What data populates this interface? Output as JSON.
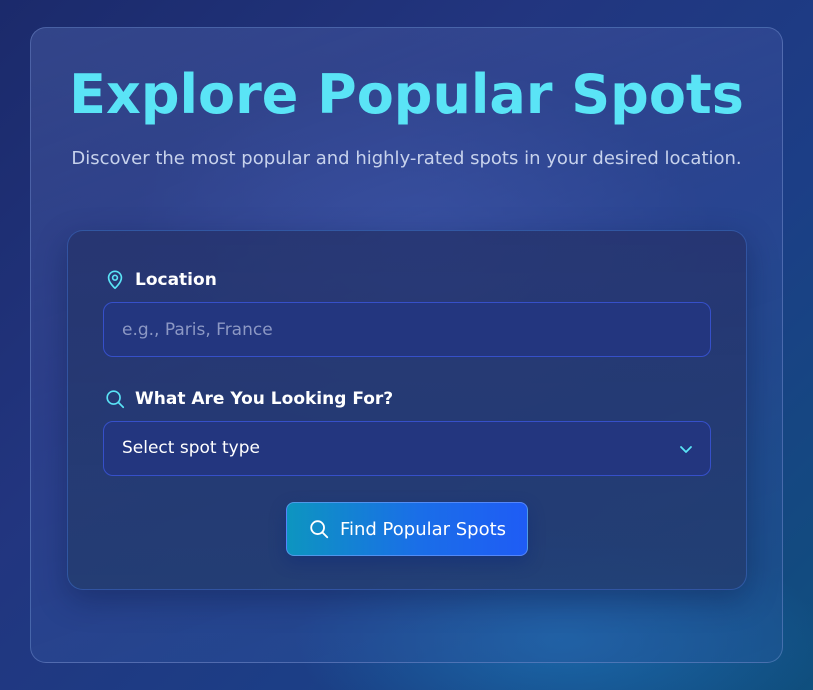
{
  "page": {
    "title": "Explore Popular Spots",
    "subtitle": "Discover the most popular and highly-rated spots in your desired location."
  },
  "form": {
    "location": {
      "label": "Location",
      "icon": "map-pin-icon",
      "value": "",
      "placeholder": "e.g., Paris, France"
    },
    "spot_type": {
      "label": "What Are You Looking For?",
      "icon": "search-icon",
      "selected": "Select spot type",
      "chevron_icon": "chevron-down-icon"
    },
    "submit": {
      "label": "Find Popular Spots",
      "icon": "search-icon"
    }
  },
  "colors": {
    "accent": "#5ae4f6",
    "button_start": "#0d95c0",
    "button_end": "#1f5cf5",
    "field_bg": "#23367f",
    "field_border": "#3650c9"
  }
}
